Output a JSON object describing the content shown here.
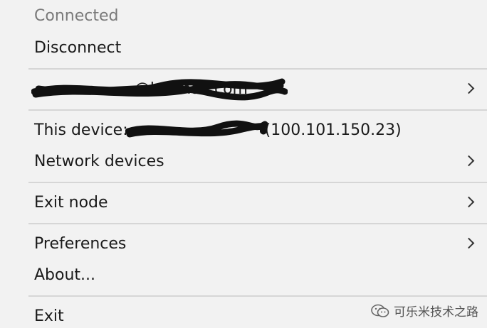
{
  "menu": {
    "status_label": "Connected",
    "disconnect_label": "Disconnect",
    "account_label": "@hotmail.com",
    "device_prefix": "This device: ",
    "device_ip": "(100.101.150.23)",
    "network_devices_label": "Network devices",
    "exit_node_label": "Exit node",
    "preferences_label": "Preferences",
    "about_label": "About...",
    "exit_label": "Exit"
  },
  "watermark": {
    "text": "可乐米技术之路"
  }
}
